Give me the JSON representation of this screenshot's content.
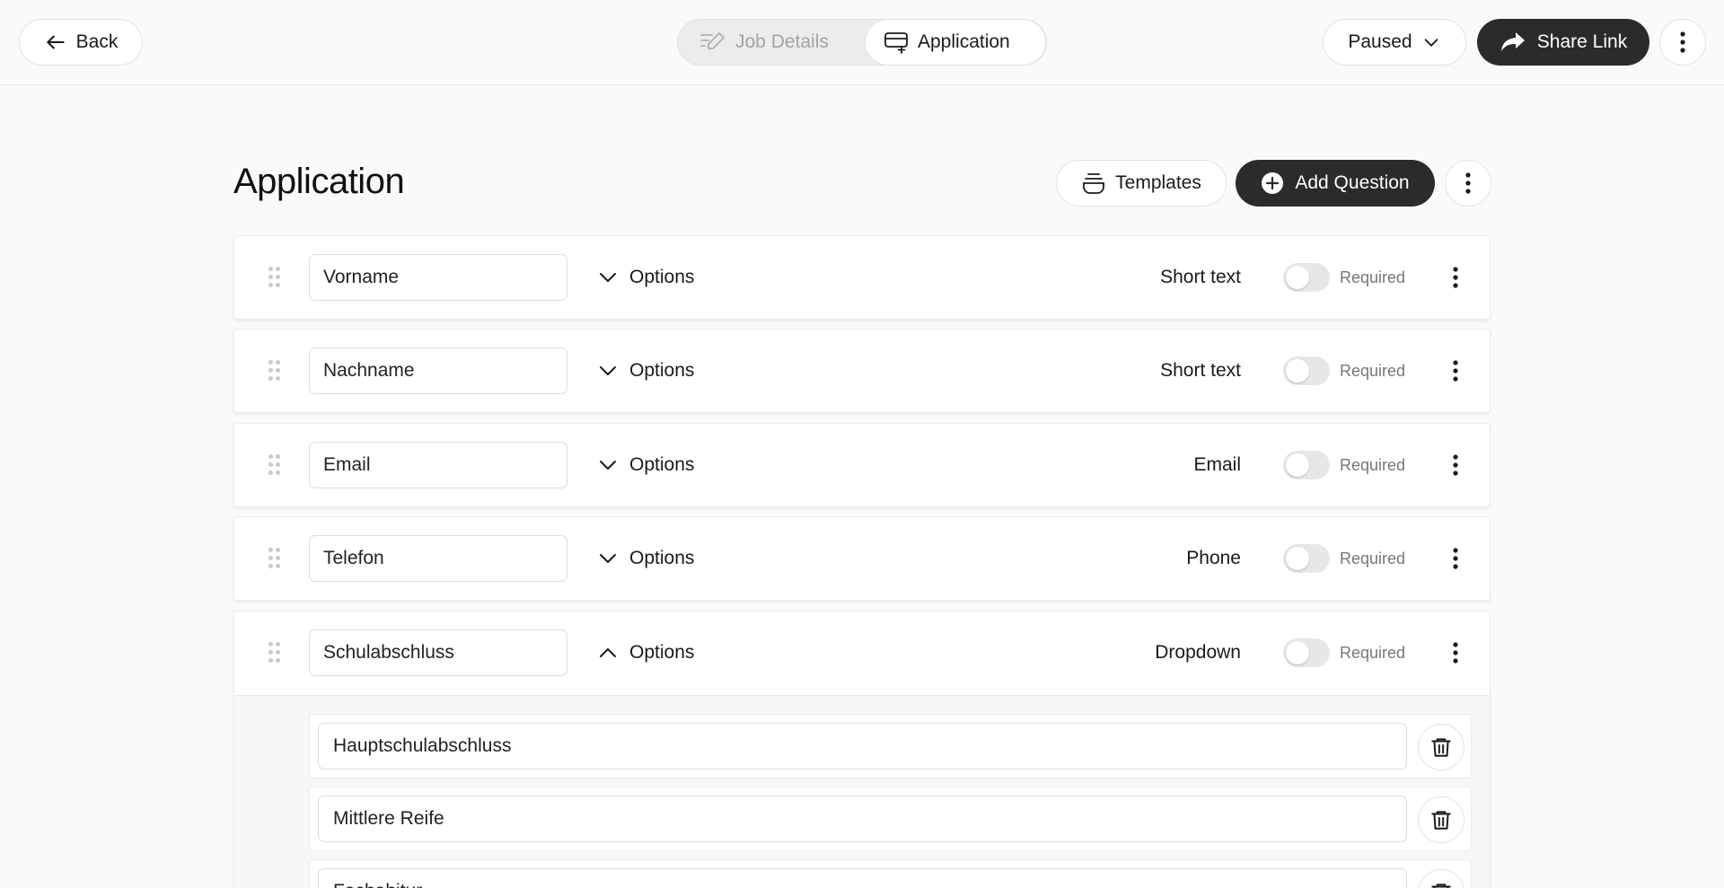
{
  "topbar": {
    "back_label": "Back",
    "tabs": [
      {
        "label": "Job Details",
        "icon": "pencil-lines-icon",
        "active": false
      },
      {
        "label": "Application",
        "icon": "form-add-icon",
        "active": true
      }
    ],
    "status_label": "Paused",
    "share_label": "Share Link"
  },
  "page": {
    "title": "Application",
    "templates_label": "Templates",
    "add_question_label": "Add Question"
  },
  "questions": [
    {
      "value": "Vorname",
      "options_label": "Options",
      "type": "Short text",
      "required_label": "Required",
      "required": false
    },
    {
      "value": "Nachname",
      "options_label": "Options",
      "type": "Short text",
      "required_label": "Required",
      "required": false
    },
    {
      "value": "Email",
      "options_label": "Options",
      "type": "Email",
      "required_label": "Required",
      "required": false
    },
    {
      "value": "Telefon",
      "options_label": "Options",
      "type": "Phone",
      "required_label": "Required",
      "required": false
    },
    {
      "value": "Schulabschluss",
      "options_label": "Options",
      "type": "Dropdown",
      "required_label": "Required",
      "required": false,
      "expanded": true,
      "options": [
        "Hauptschulabschluss",
        "Mittlere Reife",
        "Fachabitur"
      ]
    }
  ],
  "colors": {
    "accent_dark": "#2b2b2d",
    "page_bg": "#fafafa",
    "border": "#e3e3e3"
  }
}
